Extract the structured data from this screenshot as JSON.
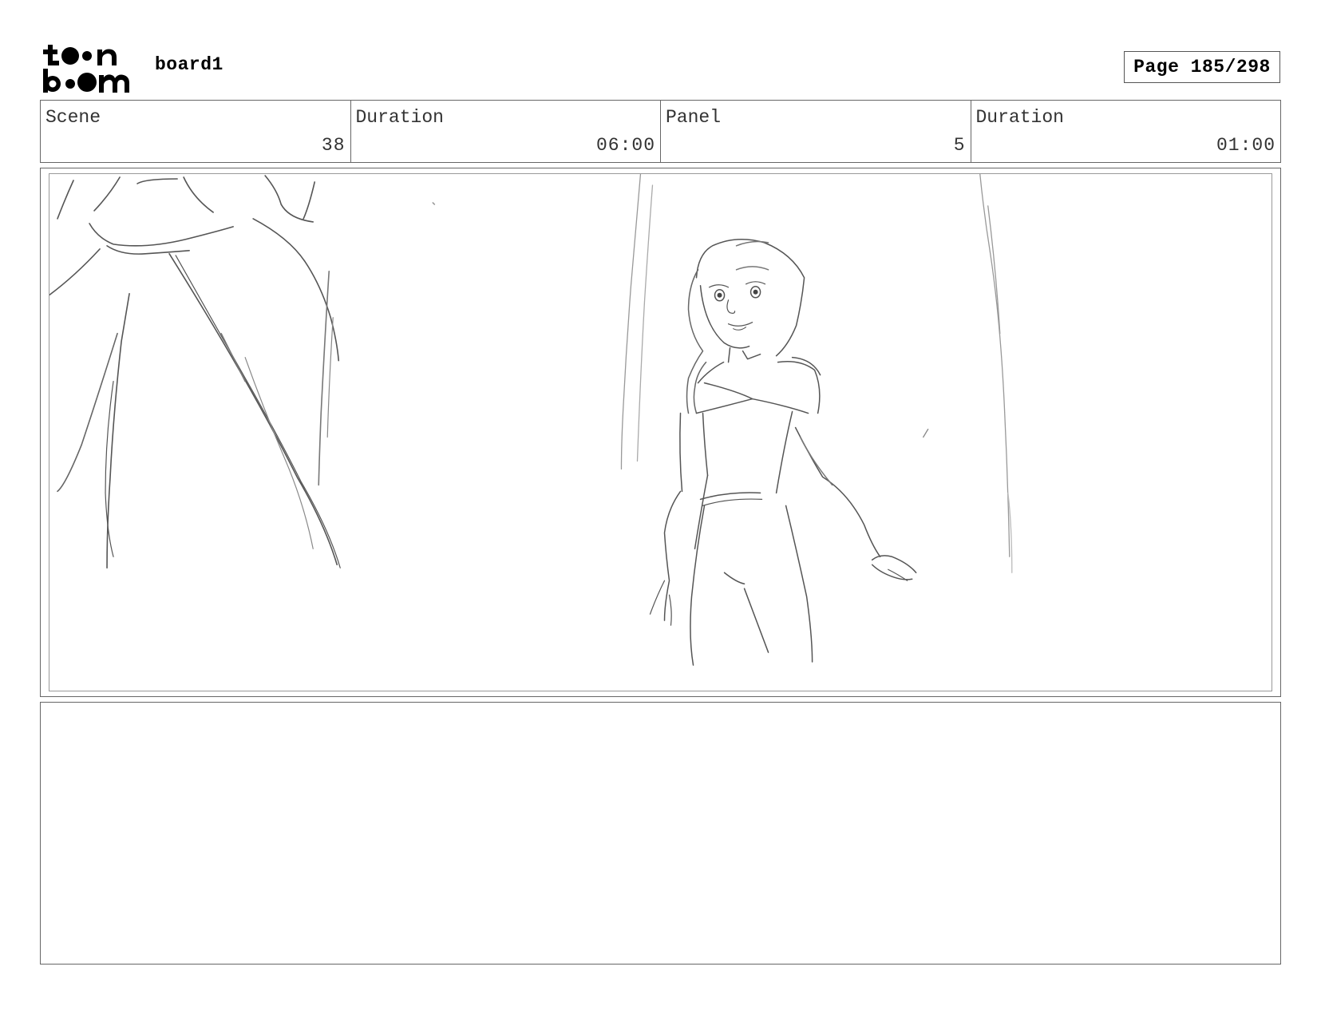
{
  "header": {
    "logo_text": "toon boom",
    "board_name": "board1",
    "page_label": "Page 185/298"
  },
  "info": {
    "scene_label": "Scene",
    "scene_value": "38",
    "scene_duration_label": "Duration",
    "scene_duration_value": "06:00",
    "panel_label": "Panel",
    "panel_value": "5",
    "panel_duration_label": "Duration",
    "panel_duration_value": "01:00"
  },
  "notes": {
    "text": ""
  }
}
